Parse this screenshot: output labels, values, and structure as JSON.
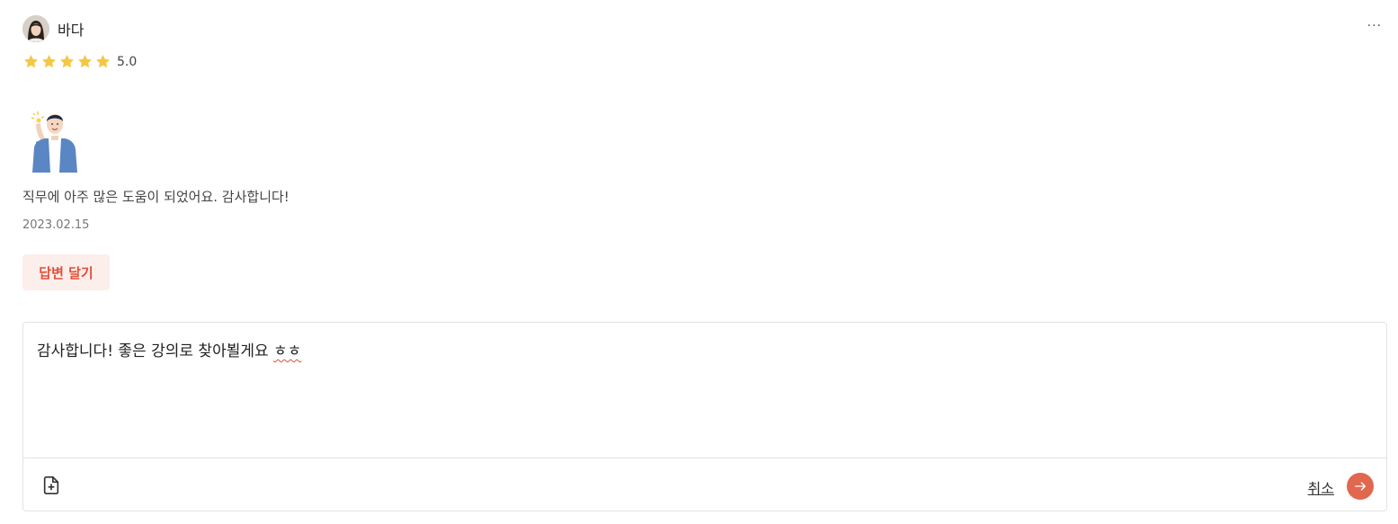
{
  "review": {
    "author_name": "바다",
    "rating_value": "5.0",
    "rating": 5,
    "rating_max": 5,
    "text": "직무에 아주 많은 도움이 되었어요. 감사합니다!",
    "date": "2023.02.15",
    "more_label": "···",
    "reply_button_label": "답변 달기"
  },
  "reply_editor": {
    "text": "감사합니다! 좋은 강의로 찾아뵐게요 ",
    "misspelled_word": "ㅎㅎ",
    "cancel_label": "취소"
  },
  "icons": {
    "star": "star-icon",
    "file_add": "file-plus-icon",
    "submit": "arrow-right-icon",
    "more": "more-horizontal-icon"
  },
  "colors": {
    "accent": "#e0684f",
    "reply_button_bg": "#fceeeb",
    "reply_button_text": "#e0503a",
    "star": "#f5c744"
  }
}
